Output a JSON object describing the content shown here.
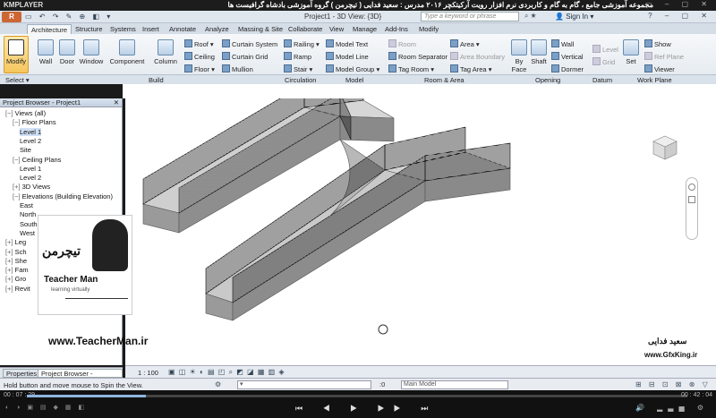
{
  "player": {
    "logo": "KMPLAYER",
    "title": "مجموعه آموزشی جامع ، گام به گام و کاربردی نرم افزار رویت آرکیتکچر ۲۰۱۶  مدرس : سعید فدایی ( تیچرمن ) گروه آموزشی بادشاه گرافیست ها",
    "time_current": "00 : 07 : 29",
    "time_total": "00 : 42 : 04"
  },
  "revit": {
    "app_button": "R",
    "doc_title": "Project1 - 3D View: {3D}",
    "search_placeholder": "Type a keyword or phrase",
    "sign_in": "Sign In"
  },
  "tabs": [
    "Architecture",
    "Structure",
    "Systems",
    "Insert",
    "Annotate",
    "Analyze",
    "Massing & Site",
    "Collaborate",
    "View",
    "Manage",
    "Add-Ins",
    "Modify"
  ],
  "ribbon": {
    "modify": "Modify",
    "select": "Select ▾",
    "wall": "Wall",
    "door": "Door",
    "window": "Window",
    "component": "Component",
    "column": "Column",
    "roof": "Roof",
    "ceiling": "Ceiling",
    "floor": "Floor",
    "curtain_system": "Curtain System",
    "curtain_grid": "Curtain Grid",
    "mullion": "Mullion",
    "railing": "Railing",
    "ramp": "Ramp",
    "stair": "Stair",
    "model_text": "Model Text",
    "model_line": "Model Line",
    "model_group": "Model Group",
    "room": "Room",
    "room_separator": "Room Separator",
    "tag_room": "Tag Room",
    "area": "Area",
    "area_boundary": "Area Boundary",
    "tag_area": "Tag Area",
    "by_face": "By Face",
    "shaft": "Shaft",
    "wall_o": "Wall",
    "vertical": "Vertical",
    "dormer": "Dormer",
    "level": "Level",
    "grid": "Grid",
    "set": "Set",
    "show": "Show",
    "ref_plane": "Ref Plane",
    "viewer": "Viewer"
  },
  "panels": [
    "Select",
    "Build",
    "Circulation",
    "Model",
    "Room & Area",
    "Opening",
    "Datum",
    "Work Plane"
  ],
  "project_browser": {
    "title": "Project Browser - Project1",
    "items": [
      {
        "label": "Views (all)",
        "level": 0,
        "sign": "−"
      },
      {
        "label": "Floor Plans",
        "level": 1,
        "sign": "−"
      },
      {
        "label": "Level 1",
        "level": 2,
        "sign": ""
      },
      {
        "label": "Level 2",
        "level": 2,
        "sign": ""
      },
      {
        "label": "Site",
        "level": 2,
        "sign": ""
      },
      {
        "label": "Ceiling Plans",
        "level": 1,
        "sign": "−"
      },
      {
        "label": "Level 1",
        "level": 2,
        "sign": ""
      },
      {
        "label": "Level 2",
        "level": 2,
        "sign": ""
      },
      {
        "label": "3D Views",
        "level": 1,
        "sign": "+"
      },
      {
        "label": "Elevations (Building Elevation)",
        "level": 1,
        "sign": "−"
      },
      {
        "label": "East",
        "level": 2,
        "sign": ""
      },
      {
        "label": "North",
        "level": 2,
        "sign": ""
      },
      {
        "label": "South",
        "level": 2,
        "sign": ""
      },
      {
        "label": "West",
        "level": 2,
        "sign": ""
      },
      {
        "label": "Leg",
        "level": 0,
        "sign": "+"
      },
      {
        "label": "Sch",
        "level": 0,
        "sign": "+"
      },
      {
        "label": "She",
        "level": 0,
        "sign": "+"
      },
      {
        "label": "Fam",
        "level": 0,
        "sign": "+"
      },
      {
        "label": "Gro",
        "level": 0,
        "sign": "+"
      },
      {
        "label": "Revit",
        "level": 0,
        "sign": "+"
      }
    ],
    "tab_properties": "Properties",
    "tab_browser": "Project Browser - Project1"
  },
  "viewbar": {
    "scale": "1 : 100"
  },
  "status": {
    "text": "Hold button and move mouse to Spin the View.",
    "main_model": "Main Model",
    "zero": ":0"
  },
  "watermark": {
    "teacher_fa": "تیچرمن",
    "teacher_en": "Teacher Man",
    "teacher_sub": "learning virtually",
    "website": "www.TeacherMan.ir",
    "author_fa": "سعید فدایی",
    "gfx_site": "www.GfxKing.ir"
  }
}
